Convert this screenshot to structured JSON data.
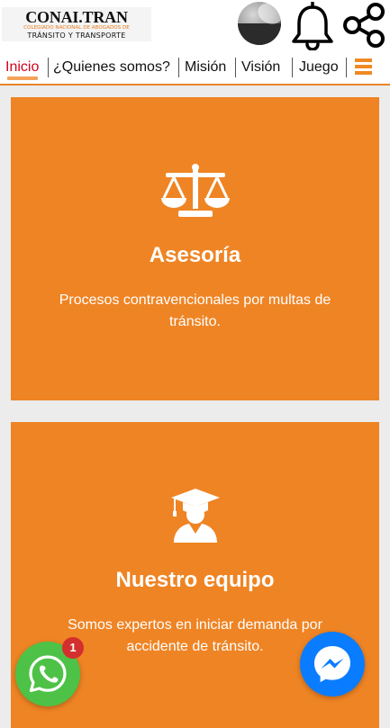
{
  "header": {
    "logo": {
      "main": "CONAI.TRAN",
      "subtitle_line1": "COLEGIADO NACIONAL DE ABOGADOS DE",
      "subtitle_line2": "TRÁNSITO Y TRANSPORTE"
    },
    "icons": [
      "avatar",
      "bell-icon",
      "share-icon"
    ]
  },
  "nav": {
    "items": [
      {
        "label": "Inicio",
        "active": true
      },
      {
        "label": "¿Quienes somos?",
        "active": false
      },
      {
        "label": "Misión",
        "active": false
      },
      {
        "label": "Visión",
        "active": false
      },
      {
        "label": "Juego",
        "active": false
      }
    ],
    "menu_icon": "hamburger-menu-icon"
  },
  "cards": [
    {
      "icon": "scales-icon",
      "title": "Asesoría",
      "text": "Procesos contravencionales por multas de tránsito."
    },
    {
      "icon": "graduate-icon",
      "title": "Nuestro equipo",
      "text": "Somos expertos en iniciar demanda por accidente de tránsito."
    }
  ],
  "floating": {
    "whatsapp_icon": "whatsapp-icon",
    "whatsapp_badge": "1",
    "messenger_icon": "messenger-icon"
  },
  "colors": {
    "accent": "#ef8424",
    "nav_active": "#d0021b",
    "whatsapp": "#4dc247",
    "messenger": "#0a7cff",
    "badge": "#d32f2f"
  }
}
